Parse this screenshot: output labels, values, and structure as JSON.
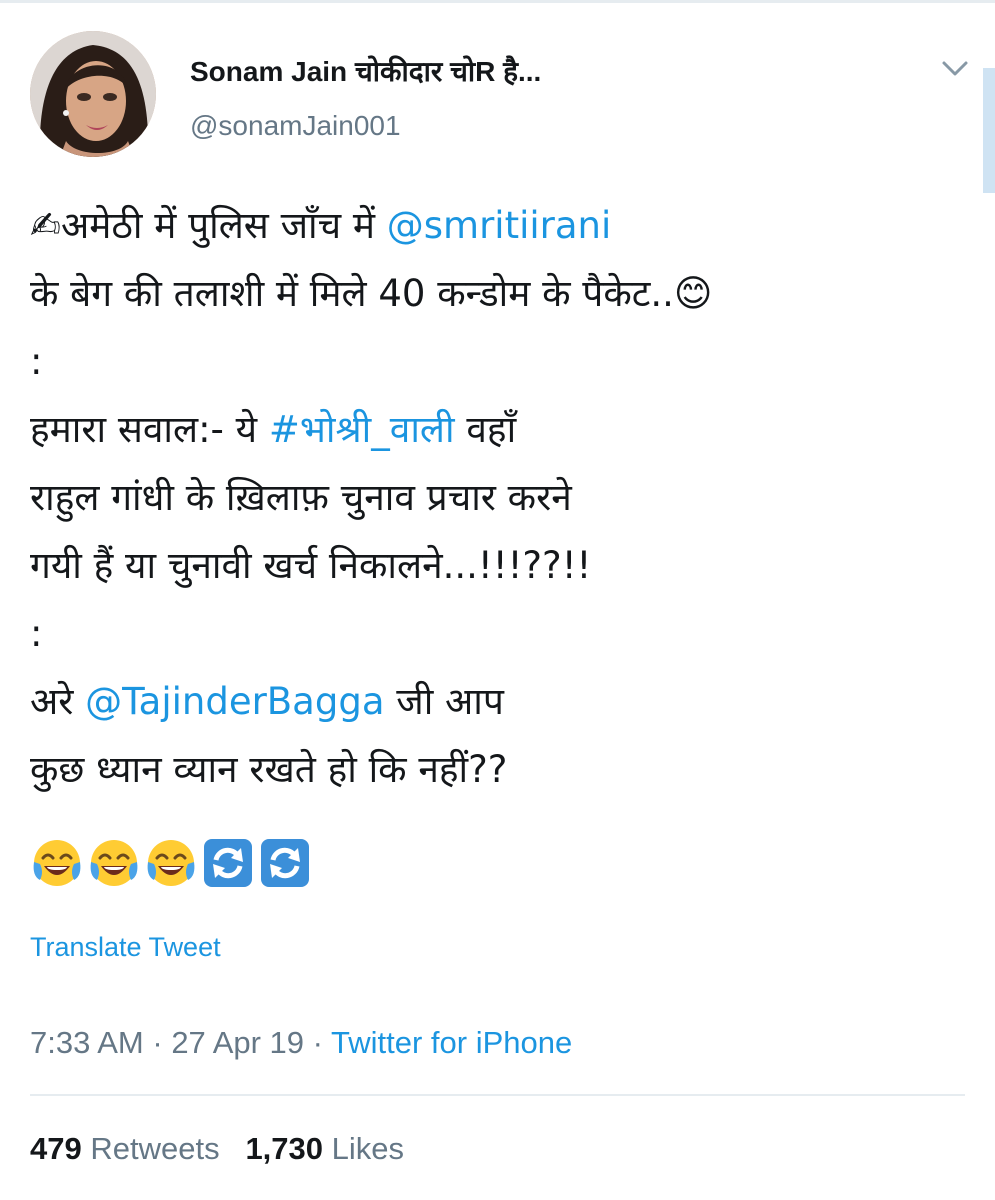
{
  "user": {
    "display_name": "Sonam Jain चोकीदार चोR है...",
    "handle": "@sonamJain001"
  },
  "tweet": {
    "lines": [
      {
        "pre": "✍अमेठी में पुलिस जाँच में ",
        "link": "@smritiirani",
        "post": ""
      },
      {
        "pre": "के बेग की तलाशी में मिले 40 कन्डोम के पैकेट..😊",
        "link": "",
        "post": ""
      },
      {
        "pre": ":",
        "link": "",
        "post": ""
      },
      {
        "pre": "हमारा सवाल:- ये ",
        "link": "#भोश्री_वाली",
        "post": " वहाँ"
      },
      {
        "pre": "राहुल गांधी के ख़िलाफ़ चुनाव प्रचार करने",
        "link": "",
        "post": ""
      },
      {
        "pre": "गयी हैं या चुनावी खर्च निकालने...!!!??!!",
        "link": "",
        "post": ""
      },
      {
        "pre": ":",
        "link": "",
        "post": ""
      },
      {
        "pre": "अरे ",
        "link": "@TajinderBagga",
        "post": " जी आप"
      },
      {
        "pre": "कुछ ध्यान व्यान रखते हो कि नहीं??",
        "link": "",
        "post": ""
      }
    ],
    "emojis": [
      "face-with-tears-of-joy-icon",
      "face-with-tears-of-joy-icon",
      "face-with-tears-of-joy-icon",
      "counterclockwise-arrows-icon",
      "counterclockwise-arrows-icon"
    ],
    "translate_label": "Translate Tweet"
  },
  "meta": {
    "time": "7:33 AM",
    "sep1": " · ",
    "date": "27 Apr 19",
    "sep2": " · ",
    "source": "Twitter for iPhone"
  },
  "stats": {
    "retweets_count": "479",
    "retweets_label": "Retweets",
    "likes_count": "1,730",
    "likes_label": "Likes"
  },
  "colors": {
    "link": "#1b95e0",
    "secondary_text": "#657786",
    "primary_text": "#14171a",
    "divider": "#e6ecf0"
  }
}
